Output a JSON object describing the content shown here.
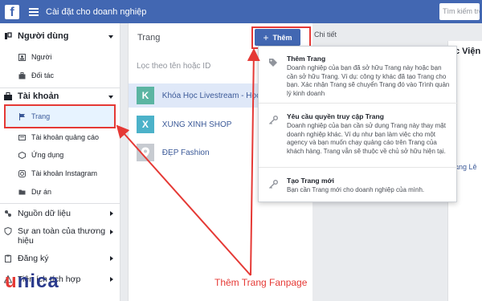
{
  "topbar": {
    "title": "Cài đặt cho doanh nghiệp",
    "search_placeholder": "Tìm kiếm trong"
  },
  "sidebar": {
    "sections": [
      {
        "label": "Người dùng",
        "items": [
          "Người",
          "Đối tác"
        ]
      },
      {
        "label": "Tài khoản",
        "items": [
          "Trang",
          "Tài khoản quảng cáo",
          "Ứng dụng",
          "Tài khoản Instagram",
          "Dự án"
        ]
      }
    ],
    "more": [
      "Nguồn dữ liệu",
      "Sự an toàn của thương hiệu",
      "Đăng ký",
      "Tiện ích tích hợp"
    ],
    "active": "Trang"
  },
  "pages": {
    "header": "Trang",
    "filter_placeholder": "Lọc theo tên hoặc ID",
    "list": [
      {
        "initial": "K",
        "name": "Khóa Học Livestream - Học",
        "color": "#5bb5a2"
      },
      {
        "initial": "X",
        "name": "XÙNG XÌNH SHOP",
        "color": "#4cb2c9"
      },
      {
        "initial": "",
        "name": "ĐẸP Fashion",
        "color": "#c7cbd1"
      }
    ]
  },
  "add_button": {
    "label": "Thêm"
  },
  "detail": {
    "tab": "Chi tiết",
    "title": "c Viện",
    "link": "ang Lê"
  },
  "dropdown": [
    {
      "icon": "tag-icon",
      "title": "Thêm Trang",
      "desc": "Doanh nghiệp của bạn đã sở hữu Trang này hoặc bạn cần sở hữu Trang. Ví dụ: công ty khác đã tạo Trang cho bạn. Xác nhận Trang sẽ chuyển Trang đó vào Trình quản lý kinh doanh"
    },
    {
      "icon": "key-icon",
      "title": "Yêu cầu quyền truy cập Trang",
      "desc": "Doanh nghiệp của bạn cần sử dụng Trang này thay mặt doanh nghiệp khác. Ví dụ như bạn làm việc cho một agency và bạn muốn chạy quảng cáo trên Trang của khách hàng. Trang vẫn sẽ thuộc về chủ sở hữu hiện tại."
    },
    {
      "icon": "key-icon",
      "title": "Tạo Trang mới",
      "desc": "Bạn cần Trang mới cho doanh nghiệp của mình."
    }
  ],
  "annotation": {
    "text": "Thêm Trang Fanpage",
    "color": "#e53935"
  },
  "watermark": {
    "part1": "u",
    "part2": "nica"
  }
}
